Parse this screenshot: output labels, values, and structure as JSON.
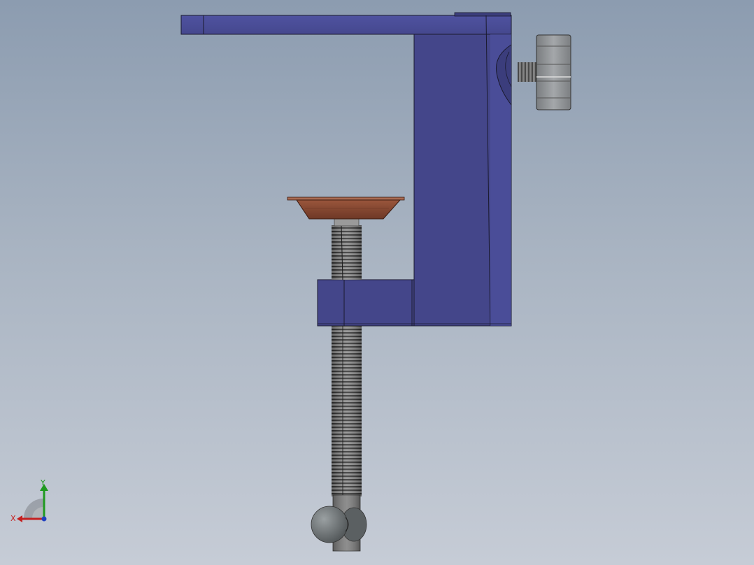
{
  "viewport": {
    "background_top": "#8c9cb0",
    "background_bottom": "#c6ccd6"
  },
  "model": {
    "parts": [
      {
        "name": "clamp-frame",
        "color": "#44468a"
      },
      {
        "name": "support-pad",
        "color": "#8a4a34"
      },
      {
        "name": "threaded-screw",
        "color": "#6c6c6c"
      },
      {
        "name": "locking-knob",
        "color": "#8d9092"
      },
      {
        "name": "handle-ball",
        "color": "#6e7476"
      }
    ]
  },
  "triad": {
    "x_label": "X",
    "y_label": "Y",
    "x_color": "#c42020",
    "y_color": "#1f9a1f",
    "z_color": "#2040c0"
  }
}
